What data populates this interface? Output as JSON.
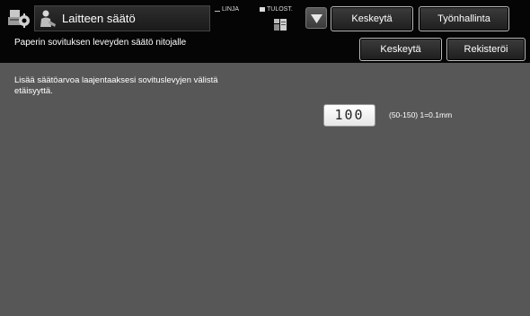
{
  "header": {
    "title": "Laitteen säätö",
    "status_line": "LINJA",
    "status_print": "TULOST.",
    "stop_label": "Keskeytä",
    "job_status_label": "Työnhallinta"
  },
  "subheader": {
    "title": "Paperin sovituksen leveyden säätö nitojalle",
    "stop_label": "Keskeytä",
    "register_label": "Rekisteröi"
  },
  "content": {
    "instruction": "Lisää säätöarvoa laajentaaksesi sovituslevyjen välistä etäisyyttä.",
    "value": "100",
    "range_hint": "(50-150) 1=0.1mm"
  },
  "icons": {
    "app": "device-settings-icon",
    "title": "person-icon",
    "print_job": "print-job-icon",
    "dropdown": "chevron-down-icon"
  }
}
